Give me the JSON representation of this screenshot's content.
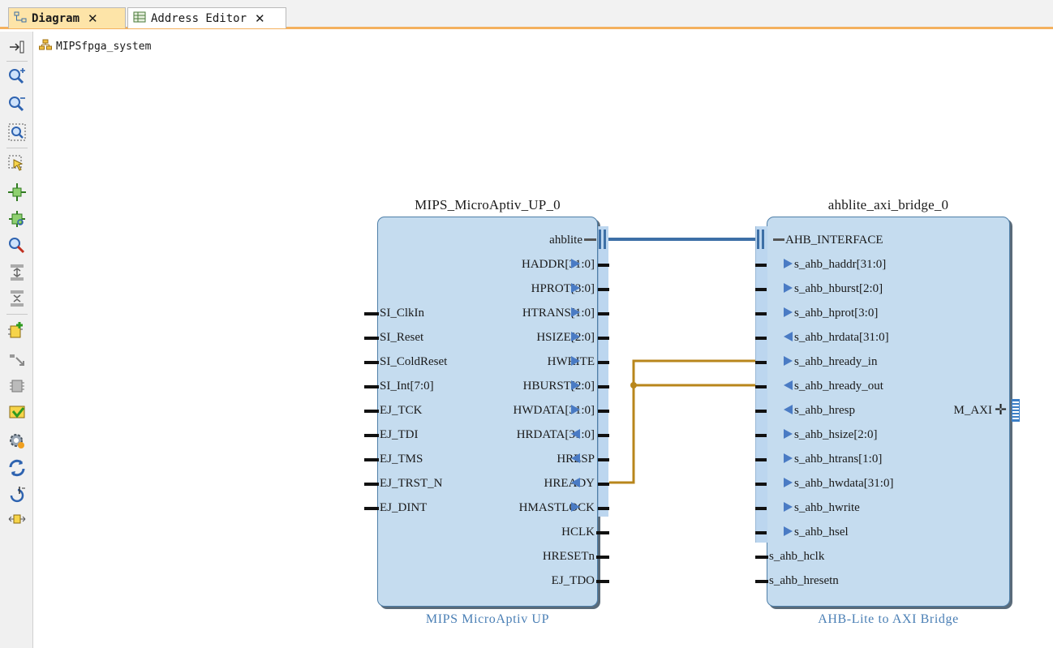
{
  "tabs": [
    {
      "label": "Diagram",
      "active": true
    },
    {
      "label": "Address Editor",
      "active": false
    }
  ],
  "breadcrumb": {
    "label": "MIPSfpga_system"
  },
  "toolbar_icons": [
    "float-icon",
    "zoom-in-icon",
    "zoom-out-icon",
    "zoom-fit-icon",
    "select-area-icon",
    "auto-fit-icon",
    "fit-selection-icon",
    "search-icon",
    "expand-icon",
    "collapse-icon",
    "add-ip-icon",
    "make-connection-icon",
    "validate-icon",
    "run-automation-icon",
    "settings-icon",
    "regenerate-layout-icon",
    "refresh-icon",
    "width-icon"
  ],
  "mips_block": {
    "name": "MIPS_MicroAptiv_UP_0",
    "subtitle": "MIPS MicroAptiv UP",
    "left_ports": [
      "SI_ClkIn",
      "SI_Reset",
      "SI_ColdReset",
      "SI_Int[7:0]",
      "EJ_TCK",
      "EJ_TDI",
      "EJ_TMS",
      "EJ_TRST_N",
      "EJ_DINT"
    ],
    "right_ports": [
      {
        "label": "ahblite",
        "dir": "bus"
      },
      {
        "label": "HADDR[31:0]",
        "dir": "out"
      },
      {
        "label": "HPROT[3:0]",
        "dir": "out"
      },
      {
        "label": "HTRANS[1:0]",
        "dir": "out"
      },
      {
        "label": "HSIZE[2:0]",
        "dir": "out"
      },
      {
        "label": "HWRITE",
        "dir": "out"
      },
      {
        "label": "HBURST[2:0]",
        "dir": "out"
      },
      {
        "label": "HWDATA[31:0]",
        "dir": "out"
      },
      {
        "label": "HRDATA[31:0]",
        "dir": "in"
      },
      {
        "label": "HRESP",
        "dir": "in"
      },
      {
        "label": "HREADY",
        "dir": "in"
      },
      {
        "label": "HMASTLOCK",
        "dir": "out"
      },
      {
        "label": "HCLK",
        "dir": "plain"
      },
      {
        "label": "HRESETn",
        "dir": "plain"
      },
      {
        "label": "EJ_TDO",
        "dir": "plain"
      }
    ]
  },
  "bridge_block": {
    "name": "ahblite_axi_bridge_0",
    "subtitle": "AHB-Lite to AXI Bridge",
    "left_ports": [
      {
        "label": "AHB_INTERFACE",
        "dir": "bus"
      },
      {
        "label": "s_ahb_haddr[31:0]",
        "dir": "in"
      },
      {
        "label": "s_ahb_hburst[2:0]",
        "dir": "in"
      },
      {
        "label": "s_ahb_hprot[3:0]",
        "dir": "in"
      },
      {
        "label": "s_ahb_hrdata[31:0]",
        "dir": "out"
      },
      {
        "label": "s_ahb_hready_in",
        "dir": "in"
      },
      {
        "label": "s_ahb_hready_out",
        "dir": "out"
      },
      {
        "label": "s_ahb_hresp",
        "dir": "out"
      },
      {
        "label": "s_ahb_hsize[2:0]",
        "dir": "in"
      },
      {
        "label": "s_ahb_htrans[1:0]",
        "dir": "in"
      },
      {
        "label": "s_ahb_hwdata[31:0]",
        "dir": "in"
      },
      {
        "label": "s_ahb_hwrite",
        "dir": "in"
      },
      {
        "label": "s_ahb_hsel",
        "dir": "in"
      },
      {
        "label": "s_ahb_hclk",
        "dir": "plain"
      },
      {
        "label": "s_ahb_hresetn",
        "dir": "plain"
      }
    ],
    "right_port": {
      "label": "M_AXI"
    }
  },
  "colors": {
    "bus_wire": "#3d6fa6",
    "net_wire": "#b8861b",
    "tab_accent": "#f4b15e",
    "block_fill": "#c5dcef"
  }
}
